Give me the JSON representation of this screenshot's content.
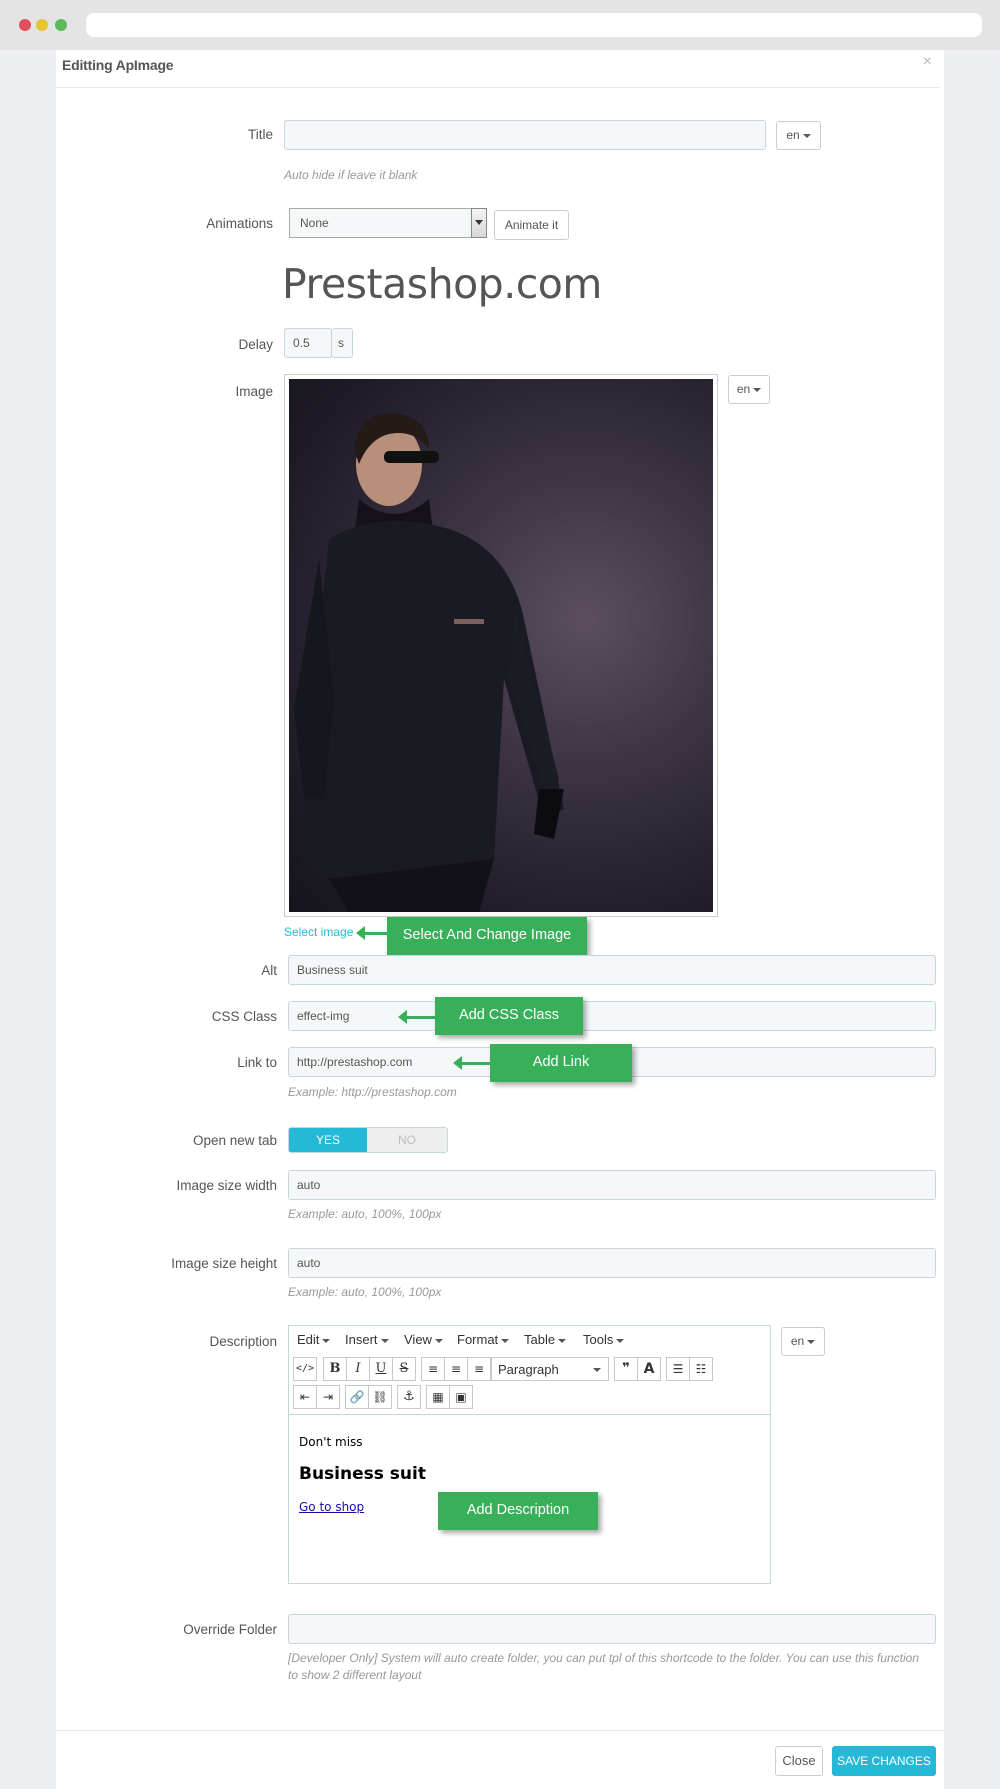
{
  "modal": {
    "title": "Editting ApImage",
    "close_glyph": "×"
  },
  "fields": {
    "title": {
      "label": "Title",
      "value": "",
      "lang": "en",
      "help": "Auto hide if leave it blank"
    },
    "animations": {
      "label": "Animations",
      "value": "None",
      "animate_button": "Animate it"
    },
    "preview_text": "Prestashop.com",
    "delay": {
      "label": "Delay",
      "value": "0.5",
      "unit": "s"
    },
    "image": {
      "label": "Image",
      "lang": "en",
      "select_link": "Select image"
    },
    "alt": {
      "label": "Alt",
      "value": "Business suit"
    },
    "css_class": {
      "label": "CSS Class",
      "value": "effect-img"
    },
    "link_to": {
      "label": "Link to",
      "value": "http://prestashop.com",
      "help": "Example: http://prestashop.com"
    },
    "open_new_tab": {
      "label": "Open new tab",
      "yes": "YES",
      "no": "NO",
      "value": "YES"
    },
    "image_width": {
      "label": "Image size width",
      "value": "auto",
      "help": "Example: auto, 100%, 100px"
    },
    "image_height": {
      "label": "Image size height",
      "value": "auto",
      "help": "Example: auto, 100%, 100px"
    },
    "description": {
      "label": "Description",
      "lang": "en",
      "menu": [
        "Edit",
        "Insert",
        "View",
        "Format",
        "Table",
        "Tools"
      ],
      "format_select": "Paragraph",
      "content_small": "Don't miss",
      "content_heading": "Business suit",
      "content_link": "Go to shop"
    },
    "override_folder": {
      "label": "Override Folder",
      "value": "",
      "help": "[Developer Only] System will auto create folder, you can put tpl of this shortcode to the folder. You can use this function to show 2 different layout"
    }
  },
  "callouts": {
    "select_image": "Select And Change Image",
    "css_class": "Add CSS Class",
    "link": "Add Link",
    "description": "Add Description"
  },
  "footer": {
    "close_button": "Close",
    "save_button": "SAVE CHANGES"
  },
  "colors": {
    "accent": "#25b9d7",
    "callout_green": "#38b05a"
  }
}
